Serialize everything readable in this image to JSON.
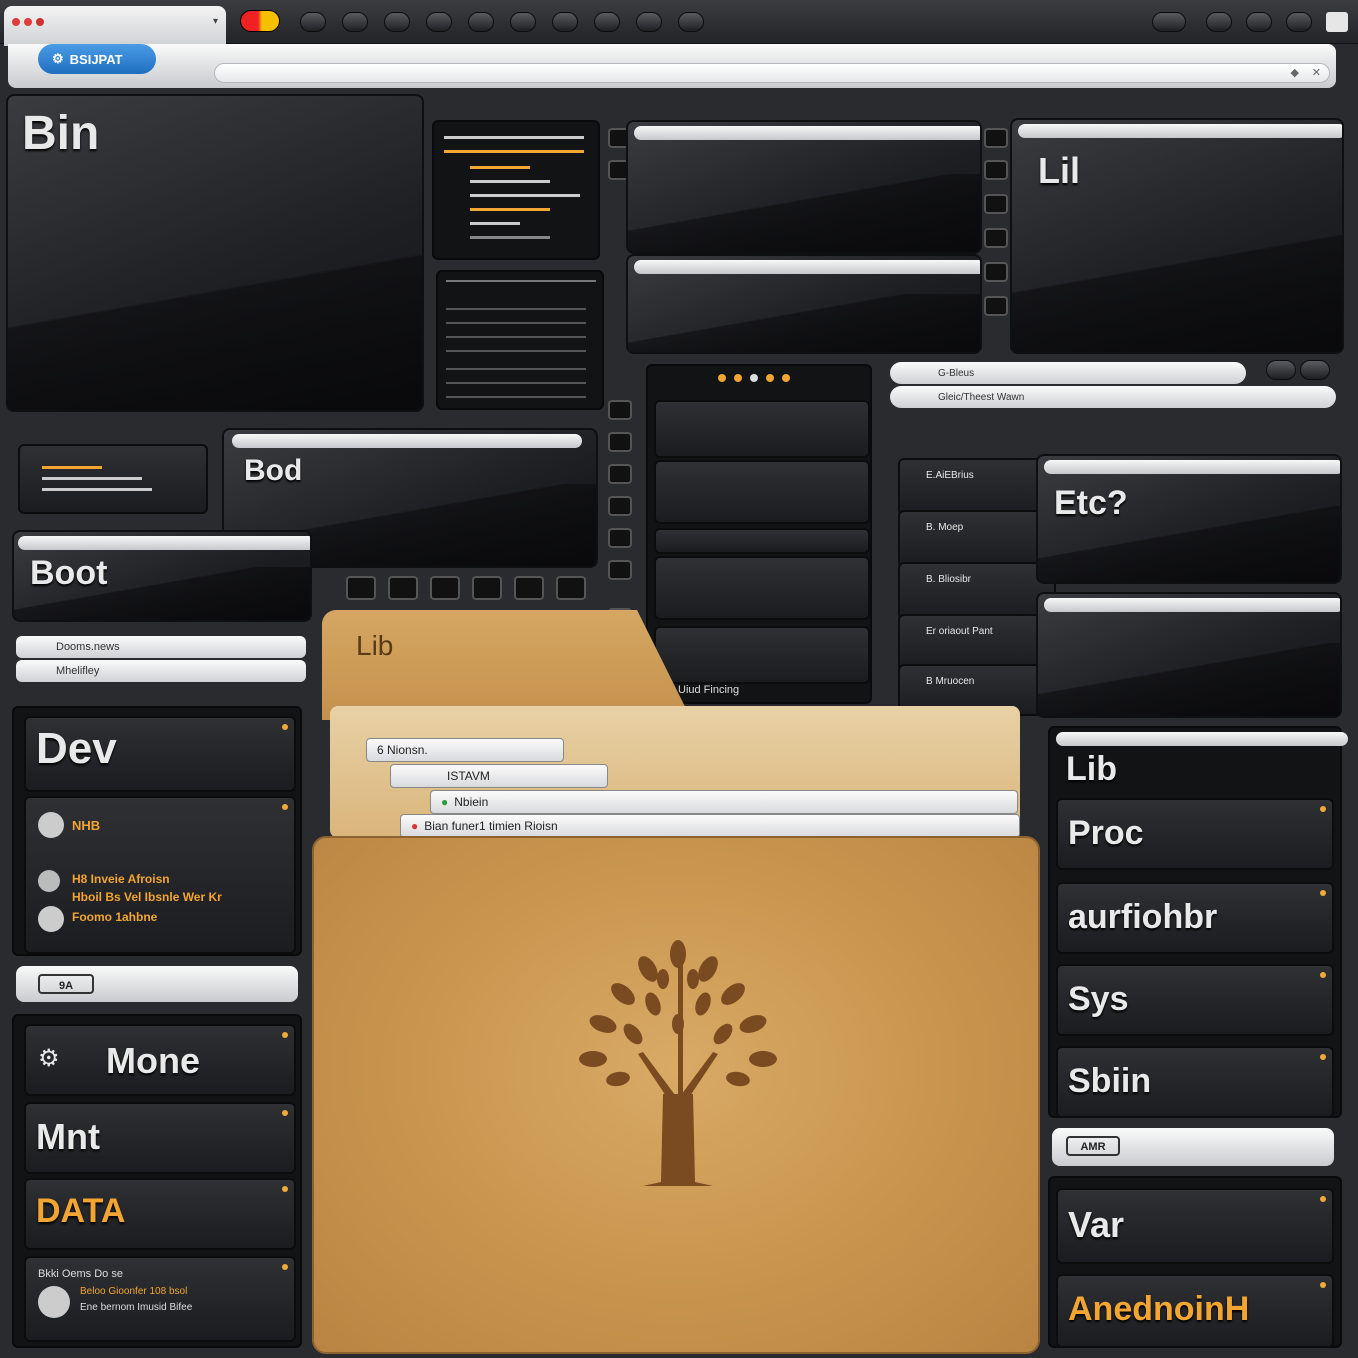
{
  "browser": {
    "tab_url": "BSIJPAT",
    "toolbar_icons": [
      "record-icon",
      "circle-icon",
      "circle-icon",
      "circle-icon",
      "circle-icon",
      "circle-icon",
      "circle-icon",
      "circle-icon",
      "circle-icon",
      "circle-icon"
    ]
  },
  "tiles": {
    "bin": "Bin",
    "lil": "Lil",
    "bod": "Bod",
    "boot": "Boot",
    "etc": "Etc?",
    "dev": "Dev",
    "mone": "Mone",
    "mnt": "Mnt",
    "data": "DATA",
    "lib_right": "Lib",
    "proc": "Proc",
    "aurfiohbr": "aurfiohbr",
    "sys": "Sys",
    "sbiin": "Sbiin",
    "var": "Var",
    "anednoinh": "AnednoinH",
    "folder_label": "Lib"
  },
  "small_labels": {
    "box_badge_left": "9A",
    "box_badge_right": "AMR",
    "bookmark_1": "Dooms.news",
    "bookmark_2": "Mhelifley",
    "url_right_1": "G-Bleus",
    "url_right_2": "Gleic/Theest Wawn",
    "dev_card_1": "NHB",
    "dev_card_2": "H8 Inveie Afroisn",
    "dev_card_3": "Hboil Bs Vel Ibsnle Wer Kr",
    "dev_card_4": "Foomo 1ahbne",
    "data_card_1": "Bkki Oems Do se",
    "data_card_2": "Beloo Gioonfer 108 bsol",
    "data_card_3": "Ene bernom Imusid Bifee",
    "folder_doc_1": "6 Nionsn.",
    "folder_doc_2": "ISTAVM",
    "folder_doc_3": "Nbiein",
    "folder_doc_4": "Bian funer1 timien Rioisn",
    "list_right_1": "E.AiEBrius",
    "list_right_2": "B. Moep",
    "list_right_3": "B. Bliosibr",
    "list_right_4": "Er oriaout Pant",
    "list_right_5": "B Mruocen",
    "mid_footer": "Uiud Fincing"
  },
  "colors": {
    "accent_orange": "#f2a531",
    "folder_tan": "#c9964f",
    "panel_dark": "#1d1e21",
    "tab_blue": "#2a7fd3"
  }
}
